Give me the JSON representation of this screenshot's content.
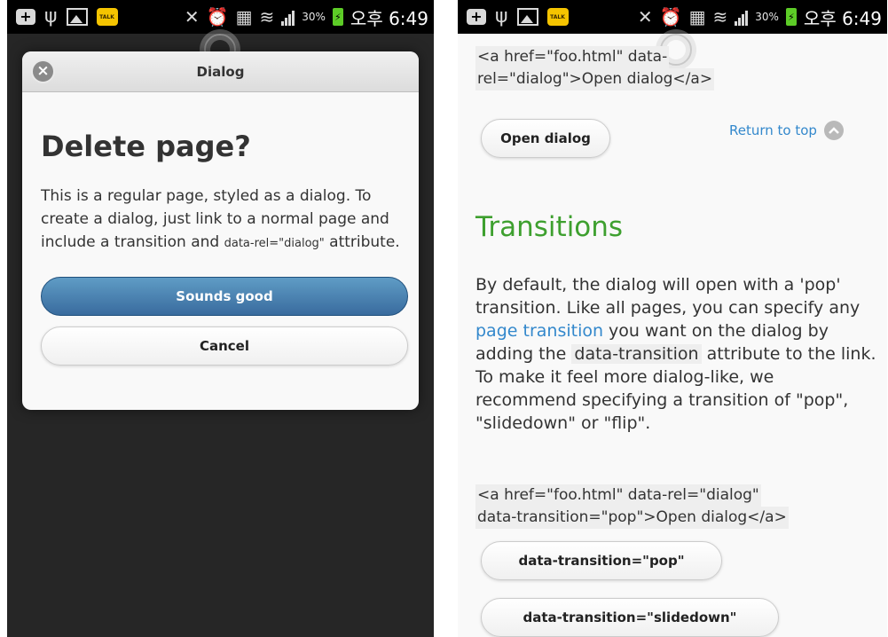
{
  "status_bar": {
    "icons": [
      "plus-icon",
      "usb-icon",
      "image-icon",
      "kakaotalk-icon",
      "mute-icon",
      "alarm-icon",
      "data-icon",
      "wifi-icon",
      "signal-icon"
    ],
    "talk_label": "TALK",
    "battery_percent": "30%",
    "time": "오후 6:49"
  },
  "dialog": {
    "close_symbol": "×",
    "header_title": "Dialog",
    "heading": "Delete page?",
    "body_prefix": "This is a regular page, styled as a dialog. To create a dialog, just link to a normal page and include a transition and ",
    "body_code": "data-rel=\"dialog\"",
    "body_suffix": " attribute.",
    "primary_button": "Sounds good",
    "secondary_button": "Cancel",
    "colors": {
      "primary": "#396b9e",
      "overlay": "#262626"
    }
  },
  "right_page": {
    "code_top": [
      "<a href=\"foo.html\" data-",
      "rel=\"dialog\">Open dialog</a>"
    ],
    "open_dialog_button": "Open dialog",
    "return_to_top": "Return to top",
    "section_title": "Transitions",
    "paragraph": {
      "text1": "By default, the dialog will open with a 'pop' transition. Like all pages, you can specify any ",
      "link": "page transition",
      "text2": " you want on the dialog by adding the ",
      "code": "data-transition",
      "text3": " attribute to the link. To make it feel more dialog-like, we recommend specifying a transition of \"pop\", \"slidedown\" or \"flip\"."
    },
    "code_bottom": [
      "<a href=\"foo.html\" data-rel=\"dialog\"",
      "data-transition=\"pop\">Open dialog</a>"
    ],
    "buttons": [
      "data-transition=\"pop\"",
      "data-transition=\"slidedown\""
    ],
    "colors": {
      "heading": "#3ea02f",
      "link": "#3388cc"
    }
  }
}
